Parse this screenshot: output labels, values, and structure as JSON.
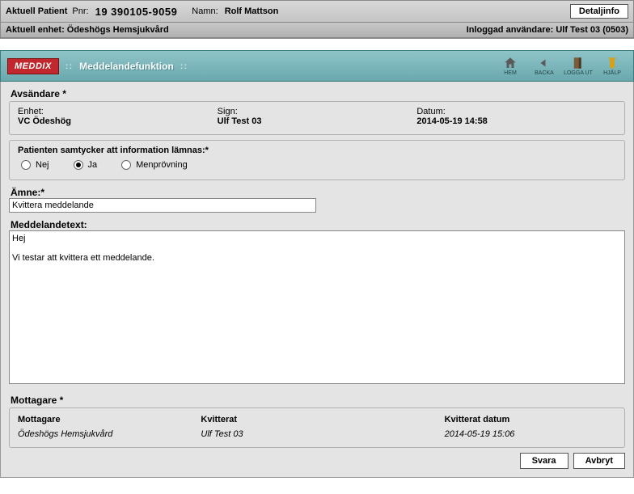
{
  "patientBar": {
    "aktuellLabel": "Aktuell Patient",
    "pnrLabel": "Pnr:",
    "pnr": "19 390105-9059",
    "namnLabel": "Namn:",
    "namn": "Rolf Mattson",
    "detaljBtn": "Detaljinfo"
  },
  "unitBar": {
    "left": "Aktuell enhet: Ödeshögs Hemsjukvård",
    "right": "Inloggad användare: Ulf Test 03 (0503)"
  },
  "tealBar": {
    "brand": "MEDDIX",
    "title": "Meddelandefunktion",
    "nav": {
      "hem": "HEM",
      "backa": "BACKA",
      "logga": "LOGGA UT",
      "hjalp": "HJÄLP"
    }
  },
  "avsandare": {
    "header": "Avsändare *",
    "enhetLabel": "Enhet:",
    "enhet": "VC Ödeshög",
    "signLabel": "Sign:",
    "sign": "Ulf Test 03",
    "datumLabel": "Datum:",
    "datum": "2014-05-19 14:58"
  },
  "consent": {
    "label": "Patienten samtycker att information lämnas:*",
    "nej": "Nej",
    "ja": "Ja",
    "men": "Menprövning",
    "selected": "ja"
  },
  "subject": {
    "label": "Ämne:*",
    "value": "Kvittera meddelande"
  },
  "message": {
    "label": "Meddelandetext:",
    "value": "Hej\n\nVi testar att kvittera ett meddelande."
  },
  "mottagare": {
    "header": "Mottagare *",
    "colMottagare": "Mottagare",
    "colKvitterat": "Kvitterat",
    "colKvDatum": "Kvitterat datum",
    "row": {
      "mottagare": "Ödeshögs Hemsjukvård",
      "kvitterat": "Ulf Test 03",
      "kvDatum": "2014-05-19 15:06"
    }
  },
  "footer": {
    "svara": "Svara",
    "avbryt": "Avbryt"
  }
}
